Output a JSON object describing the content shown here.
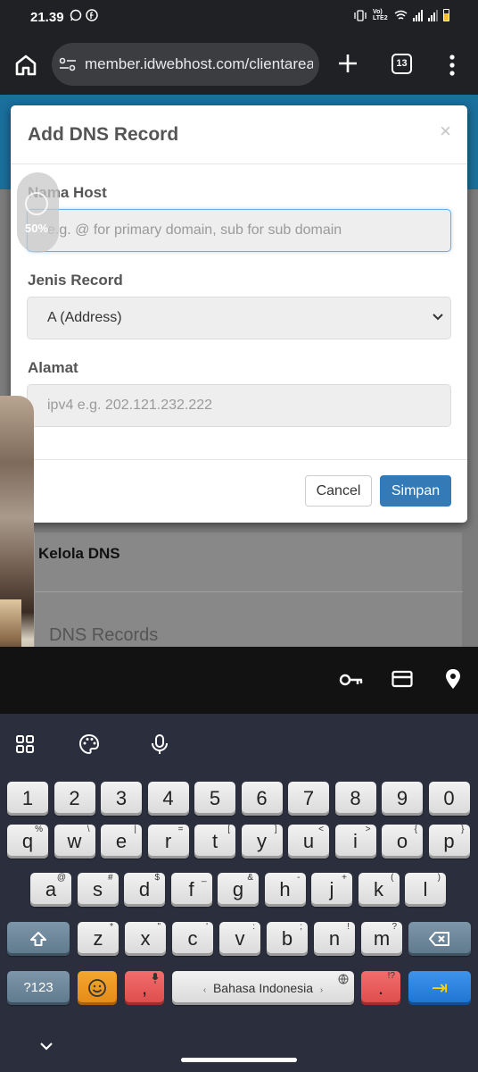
{
  "status_bar": {
    "time": "21.39",
    "left_icons": [
      "whatsapp-icon",
      "facebook-icon"
    ],
    "right_icons": [
      "vibrate-icon",
      "volte-icon",
      "wifi-icon",
      "signal-icon",
      "signal-icon",
      "battery-icon"
    ],
    "volte_label": "Vo) LTE2",
    "battery_color": "#f6c026"
  },
  "browser": {
    "url": "member.idwebhost.com/clientarea",
    "tab_count": "13"
  },
  "page": {
    "card_title": "Kelola DNS",
    "card_subtitle": "DNS Records",
    "header_color": "#1a6f9c"
  },
  "modal": {
    "title": "Add DNS Record",
    "close_symbol": "×",
    "host_label": "Nama Host",
    "host_placeholder": "e.g. @ for primary domain, sub for sub domain",
    "record_label": "Jenis Record",
    "record_value": "A (Address)",
    "address_label": "Alamat",
    "address_placeholder": "ipv4 e.g. 202.121.232.222",
    "cancel_label": "Cancel",
    "save_label": "Simpan",
    "save_color": "#337ab7"
  },
  "video_bubble": {
    "percent": "50%"
  },
  "keyboard": {
    "row_numbers": [
      "1",
      "2",
      "3",
      "4",
      "5",
      "6",
      "7",
      "8",
      "9",
      "0"
    ],
    "row_top": [
      {
        "k": "q",
        "a": "%"
      },
      {
        "k": "w",
        "a": "\\"
      },
      {
        "k": "e",
        "a": "|"
      },
      {
        "k": "r",
        "a": "="
      },
      {
        "k": "t",
        "a": "["
      },
      {
        "k": "y",
        "a": "]"
      },
      {
        "k": "u",
        "a": "<"
      },
      {
        "k": "i",
        "a": ">"
      },
      {
        "k": "o",
        "a": "{"
      },
      {
        "k": "p",
        "a": "}"
      }
    ],
    "row_mid": [
      {
        "k": "a",
        "a": "@"
      },
      {
        "k": "s",
        "a": "#"
      },
      {
        "k": "d",
        "a": "$"
      },
      {
        "k": "f",
        "a": "_"
      },
      {
        "k": "g",
        "a": "&"
      },
      {
        "k": "h",
        "a": "-"
      },
      {
        "k": "j",
        "a": "+"
      },
      {
        "k": "k",
        "a": "("
      },
      {
        "k": "l",
        "a": ")"
      }
    ],
    "row_bottom": [
      {
        "k": "z",
        "a": "*"
      },
      {
        "k": "x",
        "a": "\""
      },
      {
        "k": "c",
        "a": "'"
      },
      {
        "k": "v",
        "a": ":"
      },
      {
        "k": "b",
        "a": ";"
      },
      {
        "k": "n",
        "a": "!"
      },
      {
        "k": "m",
        "a": "?"
      }
    ],
    "symbols_label": "?123",
    "comma_label": ",",
    "space_label": "Bahasa Indonesia",
    "period_label": ".",
    "period_alt": "!?",
    "enter_symbol": "⇥"
  }
}
